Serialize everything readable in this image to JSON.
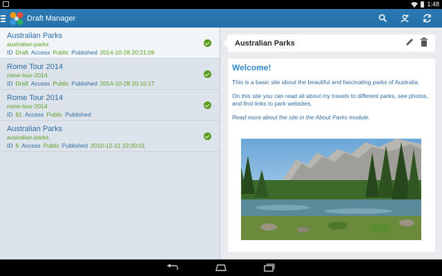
{
  "status_bar": {
    "time": "1:48"
  },
  "app": {
    "title": "Draft Manager"
  },
  "list": [
    {
      "title": "Australian Parks",
      "alias": "australian-parks",
      "id_label": "ID",
      "id": "Draft",
      "access_label": "Access",
      "access": "Public",
      "published_label": "Published",
      "published": "2014-10-28 20:21:09",
      "status": "published"
    },
    {
      "title": "Rome Tour 2014",
      "alias": "rome-tour-2014",
      "id_label": "ID",
      "id": "Draft",
      "access_label": "Access",
      "access": "Public",
      "published_label": "Published",
      "published": "2014-10-28 20:10:17",
      "status": "published"
    },
    {
      "title": "Rome Tour 2014",
      "alias": "rome-tour-2014",
      "id_label": "ID",
      "id": "81",
      "access_label": "Access",
      "access": "Public",
      "published_label": "Published",
      "published": "",
      "status": "published"
    },
    {
      "title": "Australian Parks",
      "alias": "australian-parks",
      "id_label": "ID",
      "id": "6",
      "access_label": "Access",
      "access": "Public",
      "published_label": "Published",
      "published": "2010-12-31 22:00:01",
      "status": "published"
    }
  ],
  "detail": {
    "title": "Australian Parks",
    "welcome": "Welcome!",
    "paragraphs": [
      "This is a basic site about the beautiful and fascinating parks of Australia.",
      "On this site you can read all about my travels to different parks, see photos, and find links to park websites.",
      "Read more about the site in the About Parks module."
    ]
  },
  "colors": {
    "appbar": "#2a76b0",
    "link": "#2c6aa3",
    "green": "#5c9c1c",
    "heading": "#2f86c8"
  }
}
